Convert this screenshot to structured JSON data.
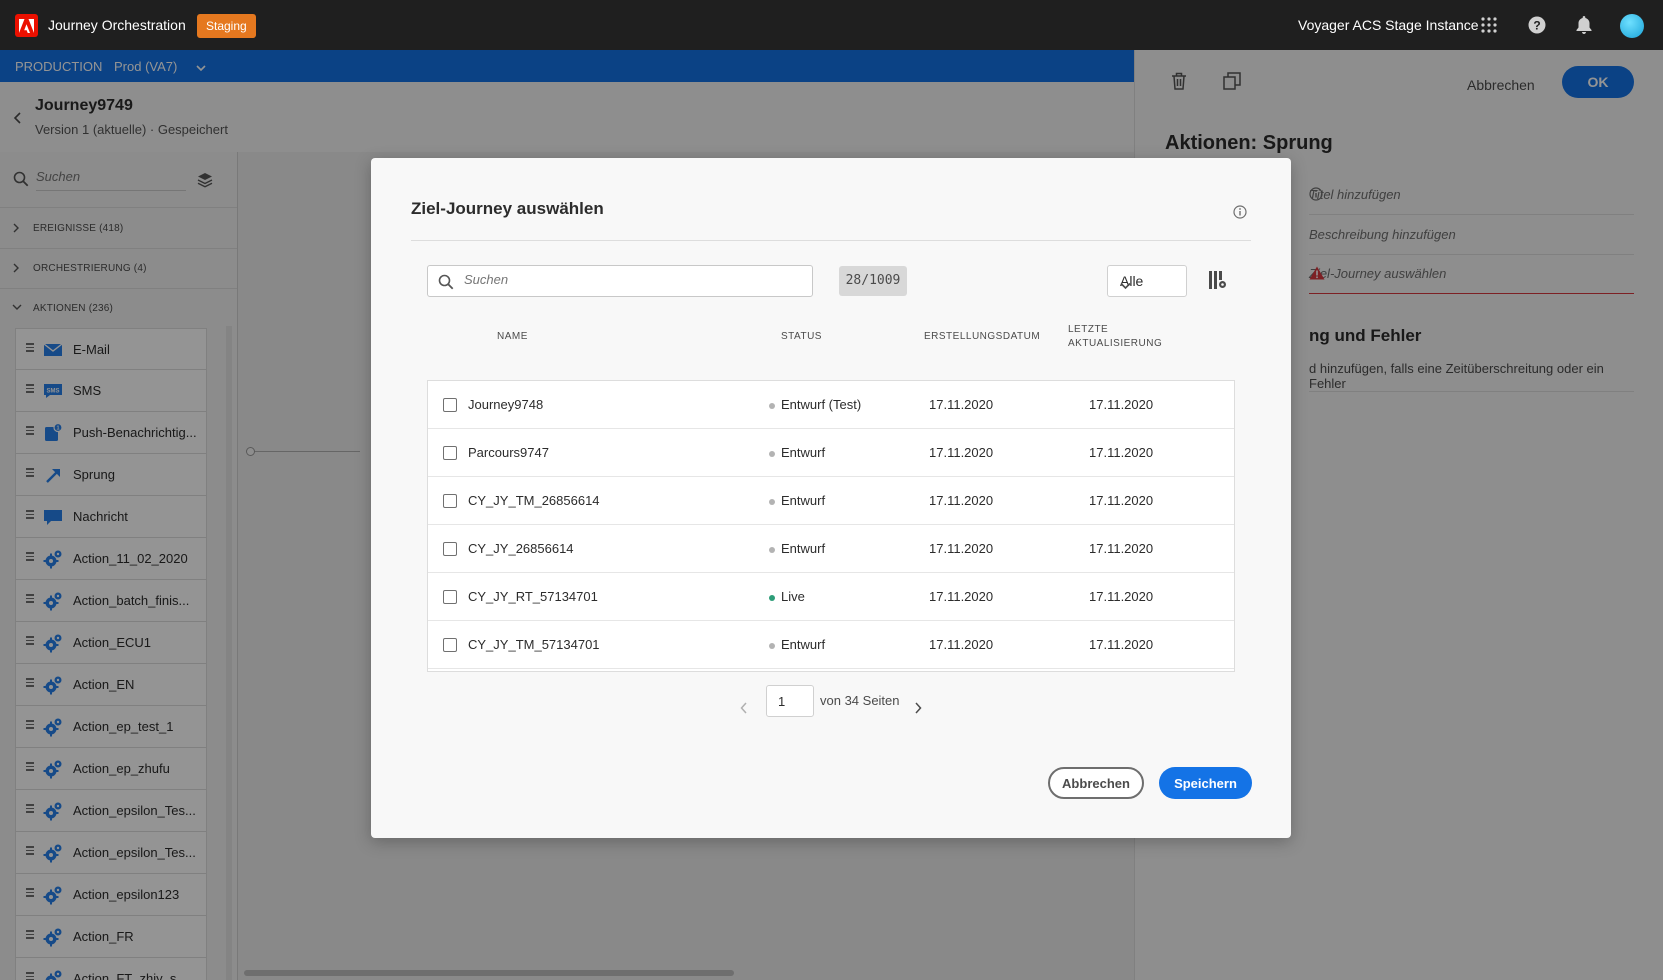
{
  "topbar": {
    "app_title": "Journey Orchestration",
    "badge": "Staging",
    "instance": "Voyager ACS Stage Instance",
    "icons": [
      "apps-grid-icon",
      "help-icon",
      "notifications-bell-icon",
      "user-avatar"
    ]
  },
  "envbar": {
    "environment": "PRODUCTION",
    "sandbox": "Prod (VA7)"
  },
  "journey": {
    "title": "Journey9749",
    "subtitle": "Version 1 (aktuelle) · Gespeichert"
  },
  "left_panel": {
    "search_placeholder": "Suchen",
    "categories": [
      {
        "label": "EREIGNISSE (418)",
        "expanded": false
      },
      {
        "label": "ORCHESTRIERUNG (4)",
        "expanded": false
      },
      {
        "label": "AKTIONEN (236)",
        "expanded": true
      }
    ],
    "actions": [
      {
        "label": "E-Mail",
        "icon": "email-icon"
      },
      {
        "label": "SMS",
        "icon": "sms-icon"
      },
      {
        "label": "Push-Benachrichtig...",
        "icon": "push-notification-icon"
      },
      {
        "label": "Sprung",
        "icon": "jump-arrow-icon"
      },
      {
        "label": "Nachricht",
        "icon": "message-bubble-icon"
      },
      {
        "label": "Action_11_02_2020",
        "icon": "custom-action-gear-icon"
      },
      {
        "label": "Action_batch_finis...",
        "icon": "custom-action-gear-icon"
      },
      {
        "label": "Action_ECU1",
        "icon": "custom-action-gear-icon"
      },
      {
        "label": "Action_EN",
        "icon": "custom-action-gear-icon"
      },
      {
        "label": "Action_ep_test_1",
        "icon": "custom-action-gear-icon"
      },
      {
        "label": "Action_ep_zhufu",
        "icon": "custom-action-gear-icon"
      },
      {
        "label": "Action_epsilon_Tes...",
        "icon": "custom-action-gear-icon"
      },
      {
        "label": "Action_epsilon_Tes...",
        "icon": "custom-action-gear-icon"
      },
      {
        "label": "Action_epsilon123",
        "icon": "custom-action-gear-icon"
      },
      {
        "label": "Action_FR",
        "icon": "custom-action-gear-icon"
      },
      {
        "label": "Action_FT_zhiy_s...",
        "icon": "custom-action-gear-icon"
      }
    ]
  },
  "right_panel": {
    "cancel_label": "Abbrechen",
    "ok_label": "OK",
    "title": "Aktionen: Sprung",
    "field_title": "Titel hinzufügen",
    "field_description": "Beschreibung hinzufügen",
    "field_target": "Ziel-Journey auswählen",
    "section_title": "ng und Fehler",
    "section_text": "d hinzufügen, falls eine Zeitüberschreitung oder ein Fehler"
  },
  "dialog": {
    "title": "Ziel-Journey auswählen",
    "search_placeholder": "Suchen",
    "count": "28/1009",
    "filter_value": "Alle",
    "columns": {
      "name": "NAME",
      "status": "STATUS",
      "created": "ERSTELLUNGSDATUM",
      "updated_line1": "LETZTE",
      "updated_line2": "AKTUALISIERUNG"
    },
    "rows": [
      {
        "name": "Journey9748",
        "status": "Entwurf (Test)",
        "status_color": "#b3b3b3",
        "created": "17.11.2020",
        "updated": "17.11.2020"
      },
      {
        "name": "Parcours9747",
        "status": "Entwurf",
        "status_color": "#b3b3b3",
        "created": "17.11.2020",
        "updated": "17.11.2020"
      },
      {
        "name": "CY_JY_TM_26856614",
        "status": "Entwurf",
        "status_color": "#b3b3b3",
        "created": "17.11.2020",
        "updated": "17.11.2020"
      },
      {
        "name": "CY_JY_26856614",
        "status": "Entwurf",
        "status_color": "#b3b3b3",
        "created": "17.11.2020",
        "updated": "17.11.2020"
      },
      {
        "name": "CY_JY_RT_57134701",
        "status": "Live",
        "status_color": "#2d9d78",
        "created": "17.11.2020",
        "updated": "17.11.2020"
      },
      {
        "name": "CY_JY_TM_57134701",
        "status": "Entwurf",
        "status_color": "#b3b3b3",
        "created": "17.11.2020",
        "updated": "17.11.2020"
      }
    ],
    "pagination": {
      "current_page": "1",
      "of_pages": "von 34 Seiten"
    },
    "cancel_label": "Abbrechen",
    "save_label": "Speichern"
  },
  "colors": {
    "accent": "#1473e6",
    "staging": "#e5781f",
    "error": "#d7373f",
    "live": "#2d9d78"
  }
}
